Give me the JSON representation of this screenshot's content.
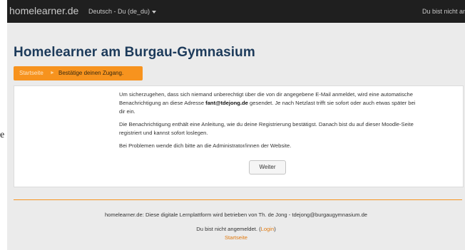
{
  "navbar": {
    "brand": "homelearner.de",
    "language": "Deutsch - Du (de_du)",
    "login_status": "Du bist nicht angemeldet."
  },
  "page": {
    "title": "Homelearner am Burgau-Gymnasium"
  },
  "breadcrumb": {
    "home": "Startseite",
    "separator": "►",
    "current": "Bestätige deinen Zugang."
  },
  "message": {
    "p1_before": "Um sicherzugehen, dass sich niemand unberechtigt über die von dir angegebene E-Mail anmeldet, wird eine automatische Benachrichtigung an diese Adresse ",
    "p1_email": "fant@tdejong.de",
    "p1_after": " gesendet. Je nach Netzlast trifft sie sofort oder auch etwas später bei dir ein.",
    "p2": "Die Benachrichtigung enthält eine Anleitung, wie du deine Registrierung bestätigst. Danach bist du auf dieser Moodle-Seite registriert und kannst sofort loslegen.",
    "p3": "Bei Problemen wende dich bitte an die Administrator/innen der Website.",
    "continue_label": "Weiter"
  },
  "footer": {
    "operator": "homelearner.de: Diese digitale Lernplattform wird betrieben von Th. de Jong - tdejong@burgaugymnasium.de",
    "login_before": "Du bist nicht angemeldet. (",
    "login_link": "Login",
    "login_after": ")",
    "home_link": "Startseite"
  },
  "margin_text": "e",
  "colors": {
    "navbar": "#1f1f1f",
    "accent": "#f7931e",
    "title": "#1c3a5a",
    "background": "#ebebeb"
  }
}
